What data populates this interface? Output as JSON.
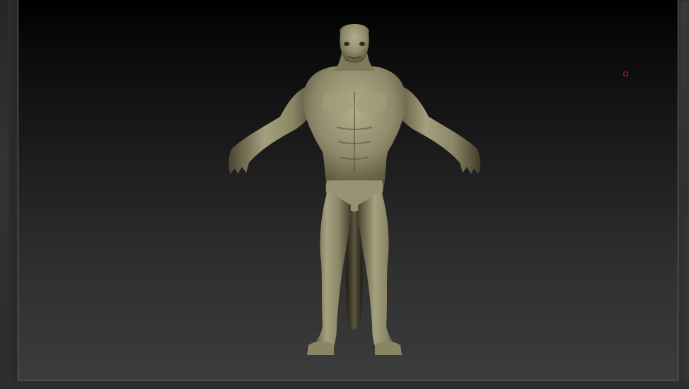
{
  "app": {
    "name": "3d-sculpt-viewport"
  },
  "colors": {
    "viewport_top": "#000000",
    "viewport_bottom": "#3c3c3c",
    "viewport_border": "#6a6a6a",
    "model_base": "#8f8a6a",
    "model_highlight": "#b8b392",
    "model_shadow": "#3e3a28",
    "gizmo": "#d01818"
  },
  "icons": {
    "gizmo": "pivot-point-icon"
  }
}
